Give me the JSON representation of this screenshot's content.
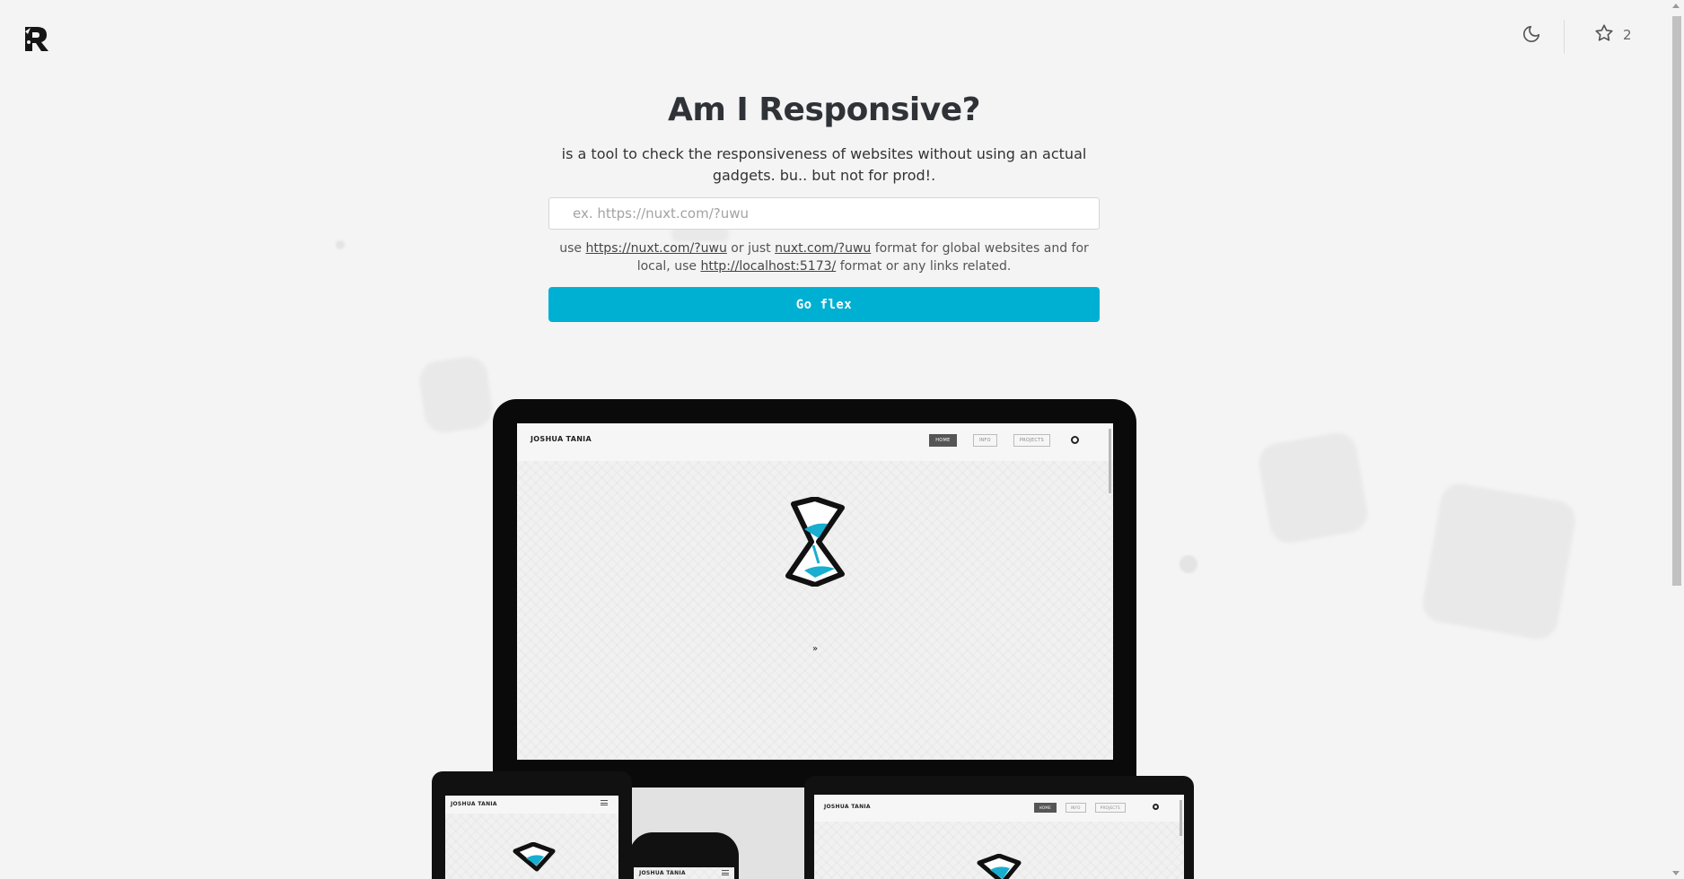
{
  "header": {
    "logo_alt": "R",
    "theme_icon": "moon-icon",
    "star_icon": "star-icon",
    "star_count": "2"
  },
  "hero": {
    "title": "Am I Responsive?",
    "subtitle": "is a tool to check the responsiveness of websites without using an actual gadgets. bu.. but not for prod!.",
    "input_placeholder": "ex. https://nuxt.com/?uwu",
    "hint": {
      "prefix": "use ",
      "link1": "https://nuxt.com/?uwu",
      "mid1": " or just ",
      "link2": "nuxt.com/?uwu",
      "mid2": " format for global websites and for local, use ",
      "link3": "http://localhost:5173/",
      "suffix": " format or any links related."
    },
    "button_label": "Go flex"
  },
  "preview": {
    "site_brand": "JOSHUA TANIA",
    "nav": [
      "HOME",
      "INFO",
      "PROJECTS"
    ],
    "accent": "#00b0d2"
  }
}
